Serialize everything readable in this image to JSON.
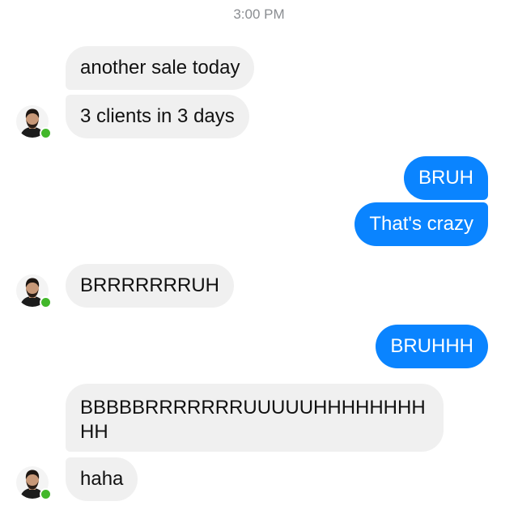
{
  "header": {
    "timestamp": "3:00 PM"
  },
  "contact": {
    "avatar_icon": "person-avatar-icon",
    "status": "online",
    "status_color": "#42b72a"
  },
  "colors": {
    "incoming_bubble": "#f0f0f0",
    "outgoing_bubble": "#0a84ff"
  },
  "messages": [
    {
      "sender": "contact",
      "text": "another sale today"
    },
    {
      "sender": "contact",
      "text": "3 clients in 3 days"
    },
    {
      "sender": "me",
      "text": "BRUH"
    },
    {
      "sender": "me",
      "text": "That's crazy"
    },
    {
      "sender": "contact",
      "text": "BRRRRRRRUH"
    },
    {
      "sender": "me",
      "text": "BRUHHH"
    },
    {
      "sender": "contact",
      "text": "BBBBBRRRRRRRUUUUUHHHHHHHHHH"
    },
    {
      "sender": "contact",
      "text": "haha"
    }
  ]
}
